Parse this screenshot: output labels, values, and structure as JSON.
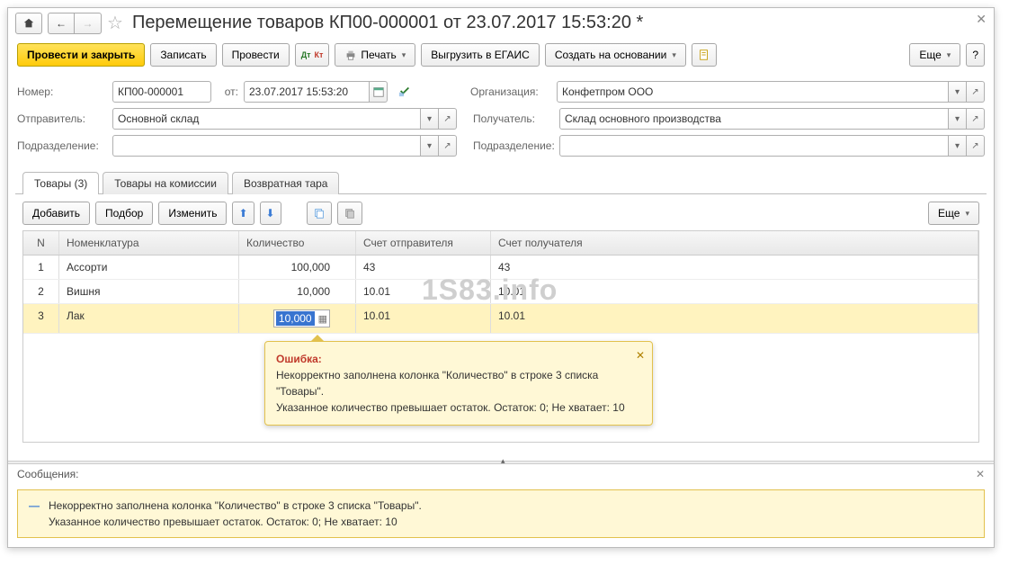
{
  "title": "Перемещение товаров КП00-000001 от 23.07.2017 15:53:20 *",
  "toolbar": {
    "post_close": "Провести и закрыть",
    "save": "Записать",
    "post": "Провести",
    "print": "Печать",
    "egais": "Выгрузить в ЕГАИС",
    "create_based": "Создать на основании",
    "more": "Еще"
  },
  "fields": {
    "number_label": "Номер:",
    "number": "КП00-000001",
    "date_label": "от:",
    "date": "23.07.2017 15:53:20",
    "org_label": "Организация:",
    "org": "Конфетпром ООО",
    "sender_label": "Отправитель:",
    "sender": "Основной склад",
    "receiver_label": "Получатель:",
    "receiver": "Склад основного производства",
    "dept_label": "Подразделение:",
    "dept1": "",
    "dept2": ""
  },
  "tabs": {
    "goods": "Товары (3)",
    "commission": "Товары на комиссии",
    "tare": "Возвратная тара"
  },
  "table_toolbar": {
    "add": "Добавить",
    "pick": "Подбор",
    "edit": "Изменить",
    "more": "Еще"
  },
  "columns": {
    "n": "N",
    "name": "Номенклатура",
    "qty": "Количество",
    "acc_sender": "Счет отправителя",
    "acc_receiver": "Счет получателя"
  },
  "rows": [
    {
      "n": "1",
      "name": "Ассорти",
      "qty": "100,000",
      "acc1": "43",
      "acc2": "43"
    },
    {
      "n": "2",
      "name": "Вишня",
      "qty": "10,000",
      "acc1": "10.01",
      "acc2": "10.01"
    },
    {
      "n": "3",
      "name": "Лак",
      "qty": "10,000",
      "acc1": "10.01",
      "acc2": "10.01"
    }
  ],
  "error": {
    "title": "Ошибка:",
    "line1": "Некорректно заполнена колонка \"Количество\" в строке 3 списка \"Товары\".",
    "line2": "Указанное количество превышает остаток. Остаток: 0; Не хватает: 10"
  },
  "messages": {
    "header": "Сообщения:",
    "line1": "Некорректно заполнена колонка \"Количество\" в строке 3 списка \"Товары\".",
    "line2": "Указанное количество превышает остаток. Остаток: 0; Не хватает: 10"
  },
  "watermark": "1S83.info"
}
